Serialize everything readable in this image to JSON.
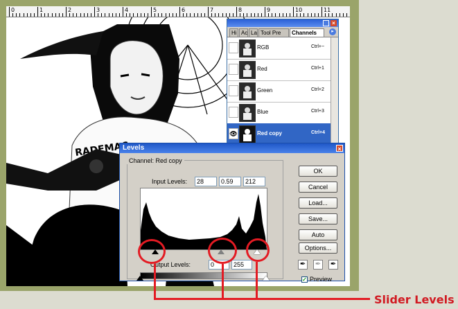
{
  "ruler": {
    "numbers": [
      "0",
      "1",
      "2",
      "3",
      "4",
      "5",
      "6",
      "7",
      "8",
      "9",
      "10",
      "11",
      "12"
    ]
  },
  "channels_panel": {
    "tabs": [
      "Hi",
      "Ac",
      "La",
      "Tool Pre",
      "Channels"
    ],
    "rows": [
      {
        "name": "RGB",
        "shortcut": "Ctrl+~"
      },
      {
        "name": "Red",
        "shortcut": "Ctrl+1"
      },
      {
        "name": "Green",
        "shortcut": "Ctrl+2"
      },
      {
        "name": "Blue",
        "shortcut": "Ctrl+3"
      },
      {
        "name": "Red copy",
        "shortcut": "Ctrl+4"
      }
    ],
    "selected": "Red copy"
  },
  "levels_dialog": {
    "title": "Levels",
    "channel_label": "Channel:",
    "channel_value": "Red copy",
    "input_levels_label": "Input Levels:",
    "input_black": "28",
    "input_gamma": "0.59",
    "input_white": "212",
    "output_levels_label": "Output Levels:",
    "output_black": "0",
    "output_white": "255",
    "buttons": {
      "ok": "OK",
      "cancel": "Cancel",
      "load": "Load...",
      "save": "Save...",
      "auto": "Auto",
      "options": "Options..."
    },
    "preview_label": "Preview",
    "preview_checked": true
  },
  "annotation": {
    "caption": "Slider Levels",
    "color": "#e31b23"
  },
  "colors": {
    "frame": "#9aa46a",
    "title_bar": "#1f57c7",
    "selection": "#3166c5"
  },
  "icons": [
    "close-icon",
    "visibility-eye-icon",
    "panel-menu-icon",
    "black-eyedropper-icon",
    "gray-eyedropper-icon",
    "white-eyedropper-icon",
    "slider-triangle-icon"
  ]
}
